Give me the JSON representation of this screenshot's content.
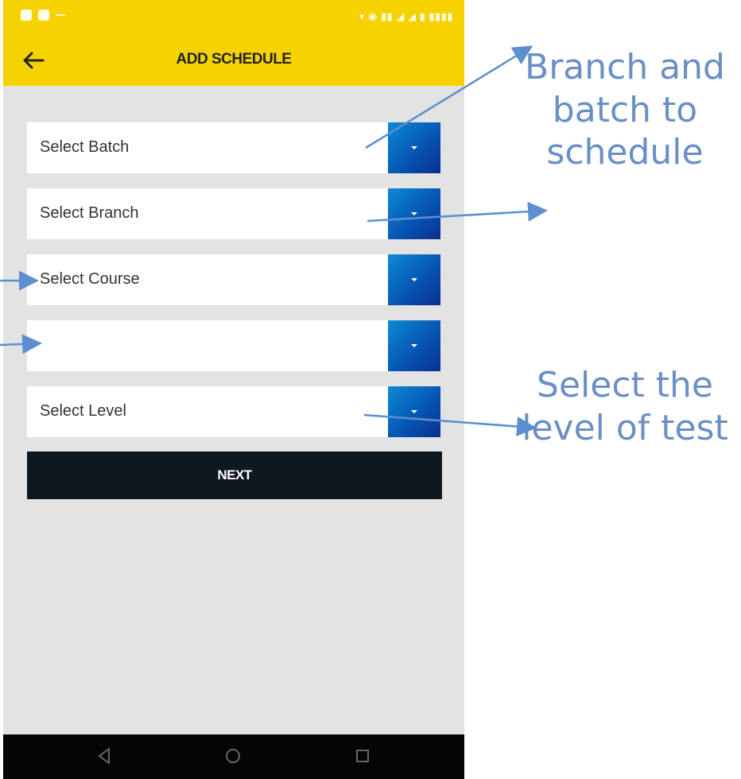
{
  "toolbar": {
    "title": "ADD SCHEDULE"
  },
  "form": {
    "batch_placeholder": "Select Batch",
    "branch_placeholder": "Select Branch",
    "course_placeholder": "Select Course",
    "fourth_value": "",
    "level_placeholder": "Select Level",
    "next_label": "NEXT"
  },
  "annotations": {
    "branch_batch_line1": "Branch and",
    "branch_batch_line2": "batch to",
    "branch_batch_line3": "schedule",
    "level_line1": "Select the",
    "level_line2": "level of test"
  },
  "colors": {
    "header": "#f6d300",
    "dropdown_button": "#0656b3",
    "next_button": "#0e1820",
    "annotation": "#6a8fc4"
  }
}
